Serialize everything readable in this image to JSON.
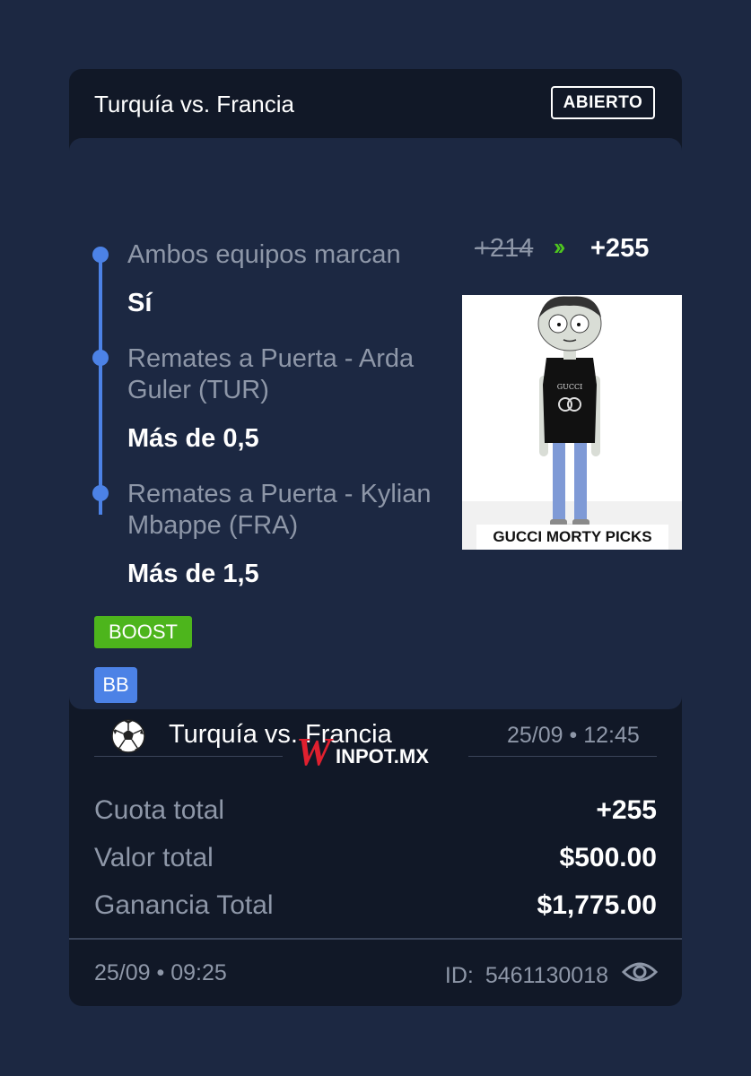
{
  "header": {
    "title": "Turquía vs. Francia",
    "status": "ABIERTO"
  },
  "odds": {
    "original": "+214",
    "boosted": "+255",
    "arrow_icon": "double-chevron-right-icon"
  },
  "legs": [
    {
      "market": "Ambos equipos marcan",
      "selection": "Sí"
    },
    {
      "market": "Remates a Puerta - Arda Guler (TUR)",
      "selection": "Más de 0,5"
    },
    {
      "market": "Remates a Puerta - Kylian Mbappe (FRA)",
      "selection": "Más de 1,5"
    }
  ],
  "meme": {
    "caption": "GUCCI MORTY PICKS",
    "shirt_text": "GUCCI"
  },
  "badges": {
    "boost": "BOOST",
    "bb": "BB"
  },
  "event": {
    "sport_icon": "soccer-ball-icon",
    "name": "Turquía vs. Francia",
    "datetime": "25/09 • 12:45"
  },
  "brand": {
    "w": "W",
    "rest": "INPOT.MX"
  },
  "summary": [
    {
      "label": "Cuota total",
      "value": "+255"
    },
    {
      "label": "Valor total",
      "value": "$500.00"
    },
    {
      "label": "Ganancia Total",
      "value": "$1,775.00"
    }
  ],
  "footer": {
    "date": "25/09 • 09:25",
    "id_label": "ID:",
    "id_value": "5461130018",
    "eye_icon": "eye-icon"
  },
  "colors": {
    "background": "#1c2842",
    "card": "#111827",
    "accent_blue": "#4c82e6",
    "boost_green": "#4db51c",
    "brand_red": "#e0202f"
  }
}
